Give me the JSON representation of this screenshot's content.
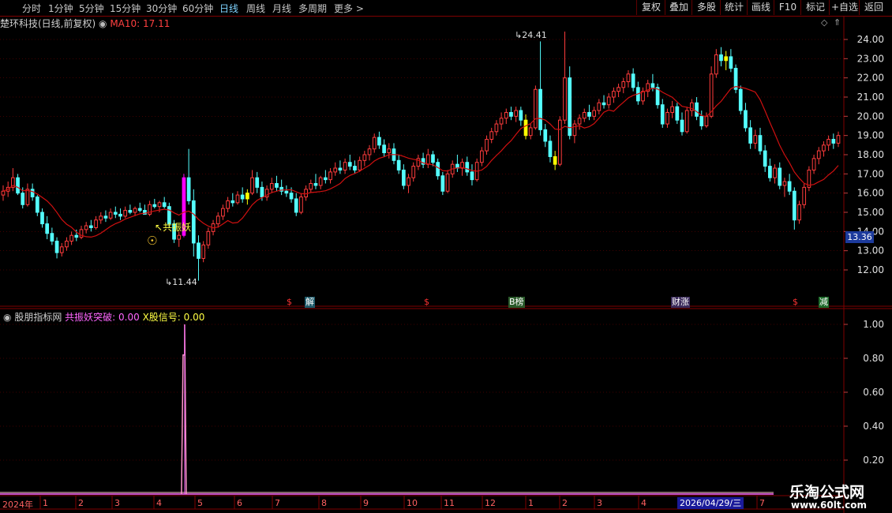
{
  "toolbar": {
    "periods": [
      "分时",
      "1分钟",
      "5分钟",
      "15分钟",
      "30分钟",
      "60分钟",
      "日线",
      "周线",
      "月线",
      "多周期",
      "更多 >"
    ],
    "buttons": [
      "复权",
      "叠加",
      "多股",
      "统计",
      "画线",
      "F10",
      "标记",
      "+自选",
      "返回"
    ]
  },
  "main_chart": {
    "title": "楚环科技(日线,前复权)",
    "gear_icon": "gear-icon",
    "ma_label": "MA10: 17.11",
    "high_label": "24.41",
    "low_label": "11.44",
    "signal_label": "共振妖",
    "current_price": "13.36",
    "y_ticks": [
      "24.00",
      "23.00",
      "22.00",
      "21.00",
      "20.00",
      "19.00",
      "18.00",
      "17.00",
      "16.00",
      "15.00",
      "14.00",
      "13.00",
      "12.00"
    ],
    "event_markers": [
      "$",
      "解",
      "$",
      "B榜",
      "财涨",
      "$",
      "减"
    ]
  },
  "indicator": {
    "name": "股朋指标网",
    "series1_label": "共振妖突破: 0.00",
    "series2_label": "X股信号: 0.00",
    "y_ticks": [
      "1.00",
      "0.80",
      "0.60",
      "0.40",
      "0.20"
    ]
  },
  "x_axis": {
    "start_label": "2024年",
    "month_labels": [
      "1",
      "2",
      "3",
      "4",
      "5",
      "6",
      "7",
      "8",
      "9",
      "10",
      "11",
      "12",
      "1",
      "2",
      "3",
      "4",
      "7"
    ],
    "cursor_date": "2026/04/29/三"
  },
  "watermark": {
    "line1": "乐淘公式网",
    "line2": "www.60lt.com"
  },
  "colors": {
    "up": "#ff3c3c",
    "down": "#54ffff",
    "ma": "#d01010",
    "signal_yellow": "#ffff00",
    "signal_magenta": "#ff00ff",
    "grid": "#800000"
  },
  "chart_data": {
    "type": "candlestick",
    "ylim": [
      11.0,
      25.0
    ],
    "indicator_ylim": [
      0,
      1.05
    ],
    "candles": [
      [
        15.9,
        16.4,
        15.6,
        16.1
      ],
      [
        16.1,
        16.6,
        15.8,
        16.3
      ],
      [
        16.3,
        17.3,
        16.1,
        16.8
      ],
      [
        16.8,
        17.0,
        15.9,
        16.0
      ],
      [
        16.0,
        16.3,
        15.2,
        15.4
      ],
      [
        15.4,
        16.5,
        15.3,
        16.2
      ],
      [
        16.2,
        16.5,
        15.6,
        15.8
      ],
      [
        15.8,
        15.9,
        14.8,
        15.0
      ],
      [
        15.0,
        15.2,
        14.2,
        14.4
      ],
      [
        14.4,
        14.8,
        13.6,
        13.9
      ],
      [
        13.9,
        14.2,
        13.3,
        13.5
      ],
      [
        13.5,
        13.7,
        12.6,
        12.9
      ],
      [
        12.9,
        13.4,
        12.7,
        13.2
      ],
      [
        13.2,
        13.7,
        13.0,
        13.5
      ],
      [
        13.5,
        14.0,
        13.3,
        13.8
      ],
      [
        13.8,
        14.1,
        13.5,
        13.7
      ],
      [
        13.7,
        14.3,
        13.6,
        14.1
      ],
      [
        14.1,
        14.5,
        13.9,
        14.3
      ],
      [
        14.3,
        14.6,
        14.0,
        14.2
      ],
      [
        14.2,
        14.8,
        14.1,
        14.6
      ],
      [
        14.6,
        15.0,
        14.4,
        14.8
      ],
      [
        14.8,
        15.1,
        14.5,
        14.7
      ],
      [
        14.7,
        15.2,
        14.6,
        15.0
      ],
      [
        15.0,
        15.3,
        14.7,
        14.9
      ],
      [
        14.9,
        15.2,
        14.6,
        14.8
      ],
      [
        14.8,
        15.3,
        14.7,
        15.1
      ],
      [
        15.1,
        15.4,
        14.9,
        15.0
      ],
      [
        15.0,
        15.3,
        14.8,
        15.2
      ],
      [
        15.2,
        15.5,
        15.0,
        15.1
      ],
      [
        15.1,
        15.4,
        14.9,
        14.9
      ],
      [
        14.9,
        15.6,
        14.8,
        15.4
      ],
      [
        15.4,
        15.7,
        15.2,
        15.3
      ],
      [
        15.3,
        15.6,
        15.0,
        15.5
      ],
      [
        15.5,
        15.8,
        15.2,
        15.3
      ],
      [
        15.3,
        15.5,
        14.2,
        14.4
      ],
      [
        14.4,
        14.6,
        13.4,
        13.6
      ],
      [
        13.6,
        14.0,
        13.2,
        13.8
      ],
      [
        13.8,
        17.0,
        13.7,
        16.8
      ],
      [
        16.8,
        18.3,
        15.4,
        15.6
      ],
      [
        15.6,
        16.2,
        12.7,
        13.4
      ],
      [
        13.4,
        13.8,
        11.44,
        12.6
      ],
      [
        12.6,
        13.5,
        12.4,
        13.3
      ],
      [
        13.3,
        14.2,
        13.1,
        14.0
      ],
      [
        14.0,
        14.6,
        13.8,
        14.4
      ],
      [
        14.4,
        15.0,
        14.2,
        14.8
      ],
      [
        14.8,
        15.4,
        14.6,
        15.2
      ],
      [
        15.2,
        15.8,
        15.0,
        15.6
      ],
      [
        15.6,
        16.0,
        15.3,
        15.5
      ],
      [
        15.5,
        16.1,
        15.4,
        15.9
      ],
      [
        15.9,
        16.3,
        15.5,
        15.7
      ],
      [
        15.7,
        16.2,
        15.4,
        16.0
      ],
      [
        16.0,
        17.2,
        15.9,
        16.8
      ],
      [
        16.8,
        17.1,
        16.0,
        16.3
      ],
      [
        16.3,
        16.6,
        15.6,
        15.8
      ],
      [
        15.8,
        16.4,
        15.6,
        16.2
      ],
      [
        16.2,
        16.8,
        16.0,
        16.5
      ],
      [
        16.5,
        16.9,
        16.1,
        16.3
      ],
      [
        16.3,
        16.7,
        15.9,
        16.1
      ],
      [
        16.1,
        16.4,
        15.8,
        16.0
      ],
      [
        16.0,
        16.3,
        15.5,
        15.7
      ],
      [
        15.7,
        16.0,
        14.8,
        15.0
      ],
      [
        15.0,
        16.0,
        14.9,
        15.8
      ],
      [
        15.8,
        16.4,
        15.6,
        16.2
      ],
      [
        16.2,
        16.7,
        16.0,
        16.5
      ],
      [
        16.5,
        17.0,
        16.2,
        16.4
      ],
      [
        16.4,
        16.9,
        16.2,
        16.8
      ],
      [
        16.8,
        17.2,
        16.5,
        16.7
      ],
      [
        16.7,
        17.3,
        16.5,
        17.1
      ],
      [
        17.1,
        17.6,
        16.9,
        17.3
      ],
      [
        17.3,
        17.7,
        17.0,
        17.2
      ],
      [
        17.2,
        17.8,
        17.0,
        17.6
      ],
      [
        17.6,
        18.0,
        17.2,
        17.4
      ],
      [
        17.4,
        17.7,
        17.0,
        17.2
      ],
      [
        17.2,
        17.9,
        17.1,
        17.7
      ],
      [
        17.7,
        18.2,
        17.4,
        18.0
      ],
      [
        18.0,
        18.5,
        17.7,
        18.3
      ],
      [
        18.3,
        19.1,
        18.1,
        18.9
      ],
      [
        18.9,
        19.2,
        18.3,
        18.5
      ],
      [
        18.5,
        18.8,
        17.9,
        18.1
      ],
      [
        18.1,
        18.6,
        17.8,
        18.3
      ],
      [
        18.3,
        18.6,
        17.5,
        17.7
      ],
      [
        17.7,
        18.0,
        17.0,
        17.2
      ],
      [
        17.2,
        17.5,
        16.2,
        16.4
      ],
      [
        16.4,
        17.0,
        16.0,
        16.8
      ],
      [
        16.8,
        17.6,
        16.6,
        17.4
      ],
      [
        17.4,
        18.0,
        17.2,
        17.8
      ],
      [
        17.8,
        18.1,
        17.3,
        17.5
      ],
      [
        17.5,
        18.3,
        17.3,
        18.0
      ],
      [
        18.0,
        18.2,
        17.4,
        17.6
      ],
      [
        17.6,
        17.8,
        16.7,
        16.9
      ],
      [
        16.9,
        17.1,
        15.9,
        16.1
      ],
      [
        16.1,
        17.2,
        16.0,
        17.0
      ],
      [
        17.0,
        17.7,
        16.8,
        17.5
      ],
      [
        17.5,
        18.0,
        17.1,
        17.3
      ],
      [
        17.3,
        17.8,
        16.9,
        17.6
      ],
      [
        17.6,
        17.9,
        16.9,
        17.1
      ],
      [
        17.1,
        17.5,
        16.4,
        16.7
      ],
      [
        16.7,
        17.8,
        16.6,
        17.6
      ],
      [
        17.6,
        18.4,
        17.4,
        18.2
      ],
      [
        18.2,
        19.0,
        18.0,
        18.8
      ],
      [
        18.8,
        19.4,
        18.6,
        19.2
      ],
      [
        19.2,
        19.8,
        19.0,
        19.6
      ],
      [
        19.6,
        20.2,
        19.3,
        19.9
      ],
      [
        19.9,
        20.4,
        19.6,
        20.2
      ],
      [
        20.2,
        20.5,
        19.8,
        20.0
      ],
      [
        20.0,
        20.5,
        19.7,
        20.3
      ],
      [
        20.3,
        20.5,
        19.5,
        19.8
      ],
      [
        19.8,
        20.1,
        18.8,
        19.0
      ],
      [
        19.0,
        19.6,
        18.8,
        19.4
      ],
      [
        19.4,
        21.6,
        19.3,
        21.4
      ],
      [
        21.4,
        23.9,
        19.0,
        19.3
      ],
      [
        19.3,
        19.6,
        18.4,
        18.7
      ],
      [
        18.7,
        19.0,
        17.6,
        17.9
      ],
      [
        17.9,
        18.2,
        17.2,
        17.5
      ],
      [
        17.5,
        20.0,
        17.4,
        19.8
      ],
      [
        19.8,
        24.41,
        19.6,
        22.0
      ],
      [
        22.0,
        22.6,
        18.8,
        19.0
      ],
      [
        19.0,
        19.8,
        18.6,
        19.6
      ],
      [
        19.6,
        20.1,
        19.3,
        19.9
      ],
      [
        19.9,
        20.4,
        19.7,
        20.2
      ],
      [
        20.2,
        20.6,
        19.8,
        20.0
      ],
      [
        20.0,
        20.5,
        19.8,
        20.3
      ],
      [
        20.3,
        20.9,
        20.1,
        20.7
      ],
      [
        20.7,
        21.1,
        20.4,
        20.6
      ],
      [
        20.6,
        21.2,
        20.4,
        21.0
      ],
      [
        21.0,
        21.5,
        20.7,
        21.3
      ],
      [
        21.3,
        21.7,
        21.0,
        21.5
      ],
      [
        21.5,
        22.0,
        21.2,
        21.8
      ],
      [
        21.8,
        22.4,
        21.5,
        22.2
      ],
      [
        22.2,
        22.5,
        21.3,
        21.5
      ],
      [
        21.5,
        21.8,
        20.6,
        20.8
      ],
      [
        20.8,
        21.5,
        20.6,
        21.3
      ],
      [
        21.3,
        21.9,
        21.0,
        21.7
      ],
      [
        21.7,
        22.2,
        21.3,
        21.5
      ],
      [
        21.5,
        21.7,
        20.4,
        20.6
      ],
      [
        20.6,
        20.9,
        19.4,
        19.6
      ],
      [
        19.6,
        20.4,
        19.4,
        20.2
      ],
      [
        20.2,
        20.8,
        19.9,
        20.5
      ],
      [
        20.5,
        20.7,
        19.6,
        19.8
      ],
      [
        19.8,
        20.2,
        19.0,
        19.2
      ],
      [
        19.2,
        20.5,
        19.1,
        20.3
      ],
      [
        20.3,
        20.9,
        20.0,
        20.7
      ],
      [
        20.7,
        21.0,
        19.8,
        20.0
      ],
      [
        20.0,
        20.3,
        19.3,
        19.5
      ],
      [
        19.5,
        20.2,
        19.4,
        20.0
      ],
      [
        20.0,
        22.6,
        19.9,
        22.2
      ],
      [
        22.2,
        23.5,
        22.0,
        23.2
      ],
      [
        23.2,
        23.6,
        22.6,
        22.9
      ],
      [
        22.9,
        23.4,
        22.4,
        23.1
      ],
      [
        23.1,
        23.5,
        22.3,
        22.5
      ],
      [
        22.5,
        22.7,
        21.2,
        21.4
      ],
      [
        21.4,
        21.6,
        20.1,
        20.3
      ],
      [
        20.3,
        20.7,
        19.2,
        19.4
      ],
      [
        19.4,
        19.8,
        18.3,
        18.6
      ],
      [
        18.6,
        19.3,
        18.3,
        19.0
      ],
      [
        19.0,
        19.4,
        18.0,
        18.2
      ],
      [
        18.2,
        18.5,
        17.1,
        17.4
      ],
      [
        17.4,
        17.8,
        16.6,
        16.8
      ],
      [
        16.8,
        17.5,
        16.5,
        17.3
      ],
      [
        17.3,
        17.6,
        16.2,
        16.4
      ],
      [
        16.4,
        16.8,
        15.8,
        16.6
      ],
      [
        16.6,
        17.0,
        15.9,
        16.1
      ],
      [
        16.1,
        16.3,
        14.1,
        14.6
      ],
      [
        14.6,
        15.6,
        14.4,
        15.4
      ],
      [
        15.4,
        16.5,
        15.2,
        16.3
      ],
      [
        16.3,
        17.4,
        16.1,
        17.2
      ],
      [
        17.2,
        18.0,
        17.0,
        17.8
      ],
      [
        17.8,
        18.4,
        17.5,
        18.2
      ],
      [
        18.2,
        18.7,
        17.9,
        18.5
      ],
      [
        18.5,
        19.0,
        18.2,
        18.8
      ],
      [
        18.8,
        19.1,
        18.3,
        18.6
      ],
      [
        18.6,
        19.2,
        18.4,
        19.0
      ]
    ],
    "resonance_signal_index": 37,
    "yellow_signal_indices": [
      50,
      107,
      113,
      148
    ]
  }
}
